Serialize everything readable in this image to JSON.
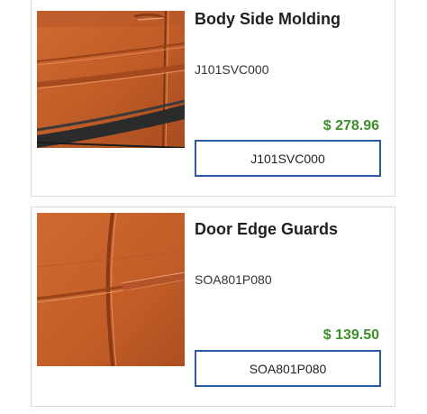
{
  "products": [
    {
      "name": "Body Side Molding",
      "sku": "J101SVC000",
      "price": "$ 278.96",
      "button_label": "J101SVC000"
    },
    {
      "name": "Door Edge Guards",
      "sku": "SOA801P080",
      "price": "$ 139.50",
      "button_label": "SOA801P080"
    }
  ],
  "colors": {
    "price_green": "#3f8f29",
    "button_border": "#2c5aa0",
    "car_paint": "#c4622d"
  }
}
